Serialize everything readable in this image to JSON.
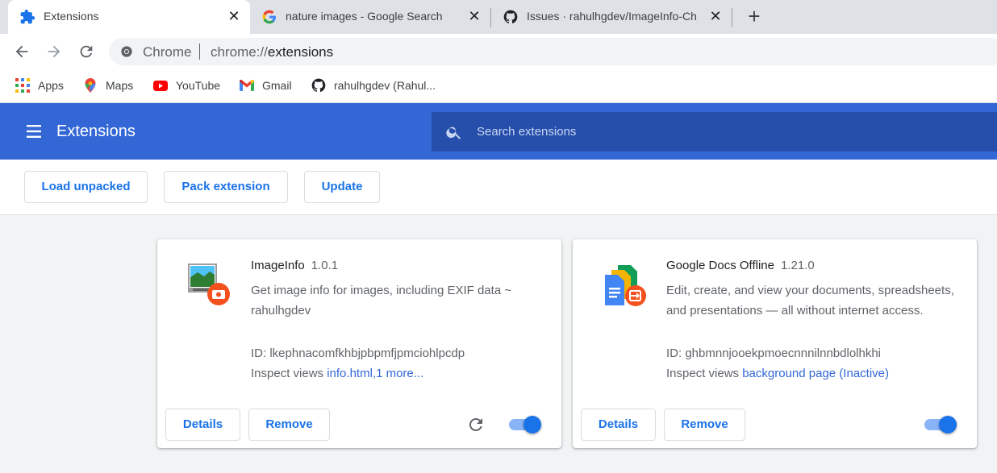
{
  "tabs": [
    {
      "title": "Extensions",
      "icon": "puzzle-icon",
      "active": true
    },
    {
      "title": "nature images - Google Search",
      "icon": "google-icon",
      "active": false
    },
    {
      "title": "Issues · rahulhgdev/ImageInfo-Ch",
      "icon": "github-icon",
      "active": false
    }
  ],
  "toolbar": {
    "omnibox_label": "Chrome",
    "url_scheme": "chrome://",
    "url_path": "extensions"
  },
  "bookmarks": [
    {
      "label": "Apps",
      "icon": "apps-grid-icon"
    },
    {
      "label": "Maps",
      "icon": "maps-pin-icon"
    },
    {
      "label": "YouTube",
      "icon": "youtube-icon"
    },
    {
      "label": "Gmail",
      "icon": "gmail-icon"
    },
    {
      "label": "rahulhgdev (Rahul...",
      "icon": "github-icon"
    }
  ],
  "header": {
    "title": "Extensions",
    "search_placeholder": "Search extensions",
    "color": "#3367d6"
  },
  "dev_buttons": {
    "load_unpacked": "Load unpacked",
    "pack_extension": "Pack extension",
    "update": "Update"
  },
  "extensions": [
    {
      "name": "ImageInfo",
      "version": "1.0.1",
      "description": "Get image info for images, including EXIF data ~ rahulhgdev",
      "id": "ID: lkephnacomfkhbjpbpmfjpmciohlpcdp",
      "inspect_label": "Inspect views",
      "inspect_link": "info.html,1 more...",
      "details_label": "Details",
      "remove_label": "Remove",
      "enabled": true,
      "has_reload": true
    },
    {
      "name": "Google Docs Offline",
      "version": "1.21.0",
      "description": "Edit, create, and view your documents, spreadsheets, and presentations — all without internet access.",
      "id": "ID: ghbmnnjooekpmoecnnnilnnbdlolhkhi",
      "inspect_label": "Inspect views",
      "inspect_link": "background page (Inactive)",
      "details_label": "Details",
      "remove_label": "Remove",
      "enabled": true,
      "has_reload": false
    }
  ]
}
